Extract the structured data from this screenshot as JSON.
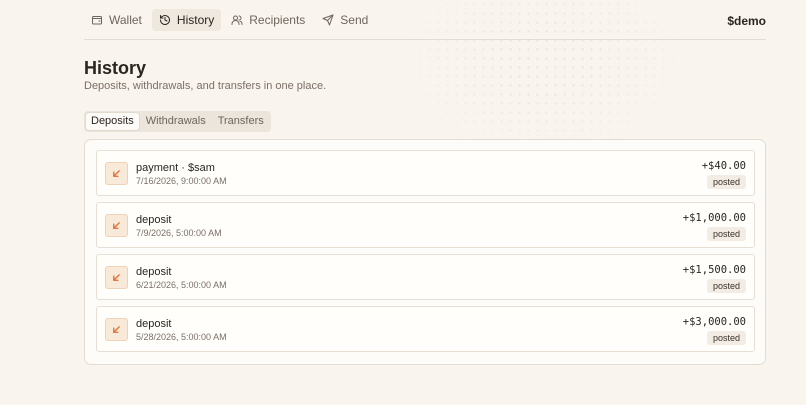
{
  "nav": {
    "items": [
      {
        "label": "Wallet",
        "icon": "wallet-icon",
        "active": false
      },
      {
        "label": "History",
        "icon": "history-icon",
        "active": true
      },
      {
        "label": "Recipients",
        "icon": "users-icon",
        "active": false
      },
      {
        "label": "Send",
        "icon": "send-icon",
        "active": false
      }
    ],
    "user": "$demo"
  },
  "page": {
    "title": "History",
    "subtitle": "Deposits, withdrawals, and transfers in one place."
  },
  "tabs": [
    {
      "label": "Deposits",
      "active": true
    },
    {
      "label": "Withdrawals",
      "active": false
    },
    {
      "label": "Transfers",
      "active": false
    }
  ],
  "transactions": [
    {
      "title": "payment · $sam",
      "time": "7/16/2026, 9:00:00 AM",
      "amount": "+$40.00",
      "status": "posted",
      "icon": "arrow-down-left-icon"
    },
    {
      "title": "deposit",
      "time": "7/9/2026, 5:00:00 AM",
      "amount": "+$1,000.00",
      "status": "posted",
      "icon": "arrow-down-left-icon"
    },
    {
      "title": "deposit",
      "time": "6/21/2026, 5:00:00 AM",
      "amount": "+$1,500.00",
      "status": "posted",
      "icon": "arrow-down-left-icon"
    },
    {
      "title": "deposit",
      "time": "5/28/2026, 5:00:00 AM",
      "amount": "+$3,000.00",
      "status": "posted",
      "icon": "arrow-down-left-icon"
    }
  ],
  "colors": {
    "background": "#faf4ee",
    "accent": "#e06a2c",
    "icon_bg": "#f9e9d8"
  }
}
